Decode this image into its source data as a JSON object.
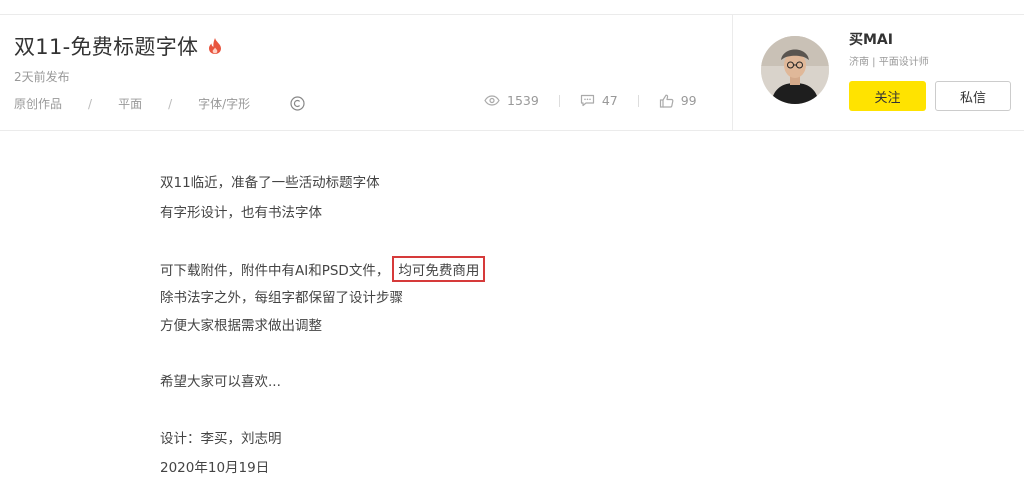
{
  "header": {
    "title": "双11-免费标题字体",
    "hot_icon": "fire-icon",
    "published": "2天前发布",
    "categories": [
      "原创作品",
      "平面",
      "字体/字形"
    ],
    "separator": "/",
    "license_icon": "copyright-icon",
    "stats": {
      "views": "1539",
      "comments": "47",
      "likes": "99"
    }
  },
  "user": {
    "name": "买MAI",
    "meta": "济南 | 平面设计师",
    "follow_label": "关注",
    "message_label": "私信"
  },
  "content": {
    "line1": "双11临近，准备了一些活动标题字体",
    "line2": "有字形设计，也有书法字体",
    "line3_prefix": "可下载附件，附件中有AI和PSD文件，",
    "line3_highlight": "均可免费商用",
    "line4": "除书法字之外，每组字都保留了设计步骤",
    "line5": "方便大家根据需求做出调整",
    "line6": "希望大家可以喜欢...",
    "line7": "设计：李买，刘志明",
    "line8": "2020年10月19日"
  },
  "colors": {
    "accent_yellow": "#ffe300",
    "highlight_red": "#d63a3a",
    "fire_red": "#e8553f"
  }
}
